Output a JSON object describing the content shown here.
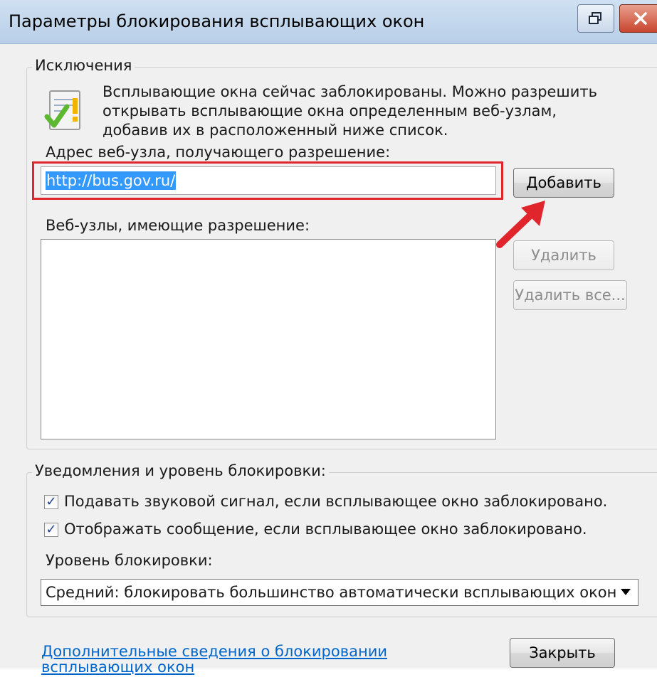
{
  "window": {
    "title": "Параметры блокирования всплывающих окон"
  },
  "exceptions": {
    "legend": "Исключения",
    "info_lines": [
      "Всплывающие окна сейчас заблокированы.  Можно разрешить",
      "открывать всплывающие окна определенным веб-узлам,",
      "добавив их в расположенный ниже список."
    ],
    "address_label": "Адрес веб-узла, получающего разрешение:",
    "address_value": "http://bus.gov.ru/",
    "add_button": "Добавить",
    "allowed_label": "Веб-узлы, имеющие разрешение:",
    "allowed_sites": [],
    "remove_button": "Удалить",
    "remove_all_button": "Удалить все..."
  },
  "notifications": {
    "legend": "Уведомления и уровень блокировки:",
    "play_sound": {
      "label": "Подавать звуковой сигнал, если всплывающее окно заблокировано.",
      "checked": true
    },
    "show_bar": {
      "label": "Отображать сообщение, если всплывающее окно заблокировано.",
      "checked": true
    },
    "level_label": "Уровень блокировки:",
    "level_value": "Средний: блокировать большинство автоматически всплывающих окон"
  },
  "footer": {
    "link_lines": [
      "Дополнительные сведения о блокировании",
      "всплывающих окон"
    ],
    "close_button": "Закрыть"
  },
  "colors": {
    "highlight_frame": "#e0262c",
    "link": "#0066cc",
    "selection": "#3399ff"
  }
}
